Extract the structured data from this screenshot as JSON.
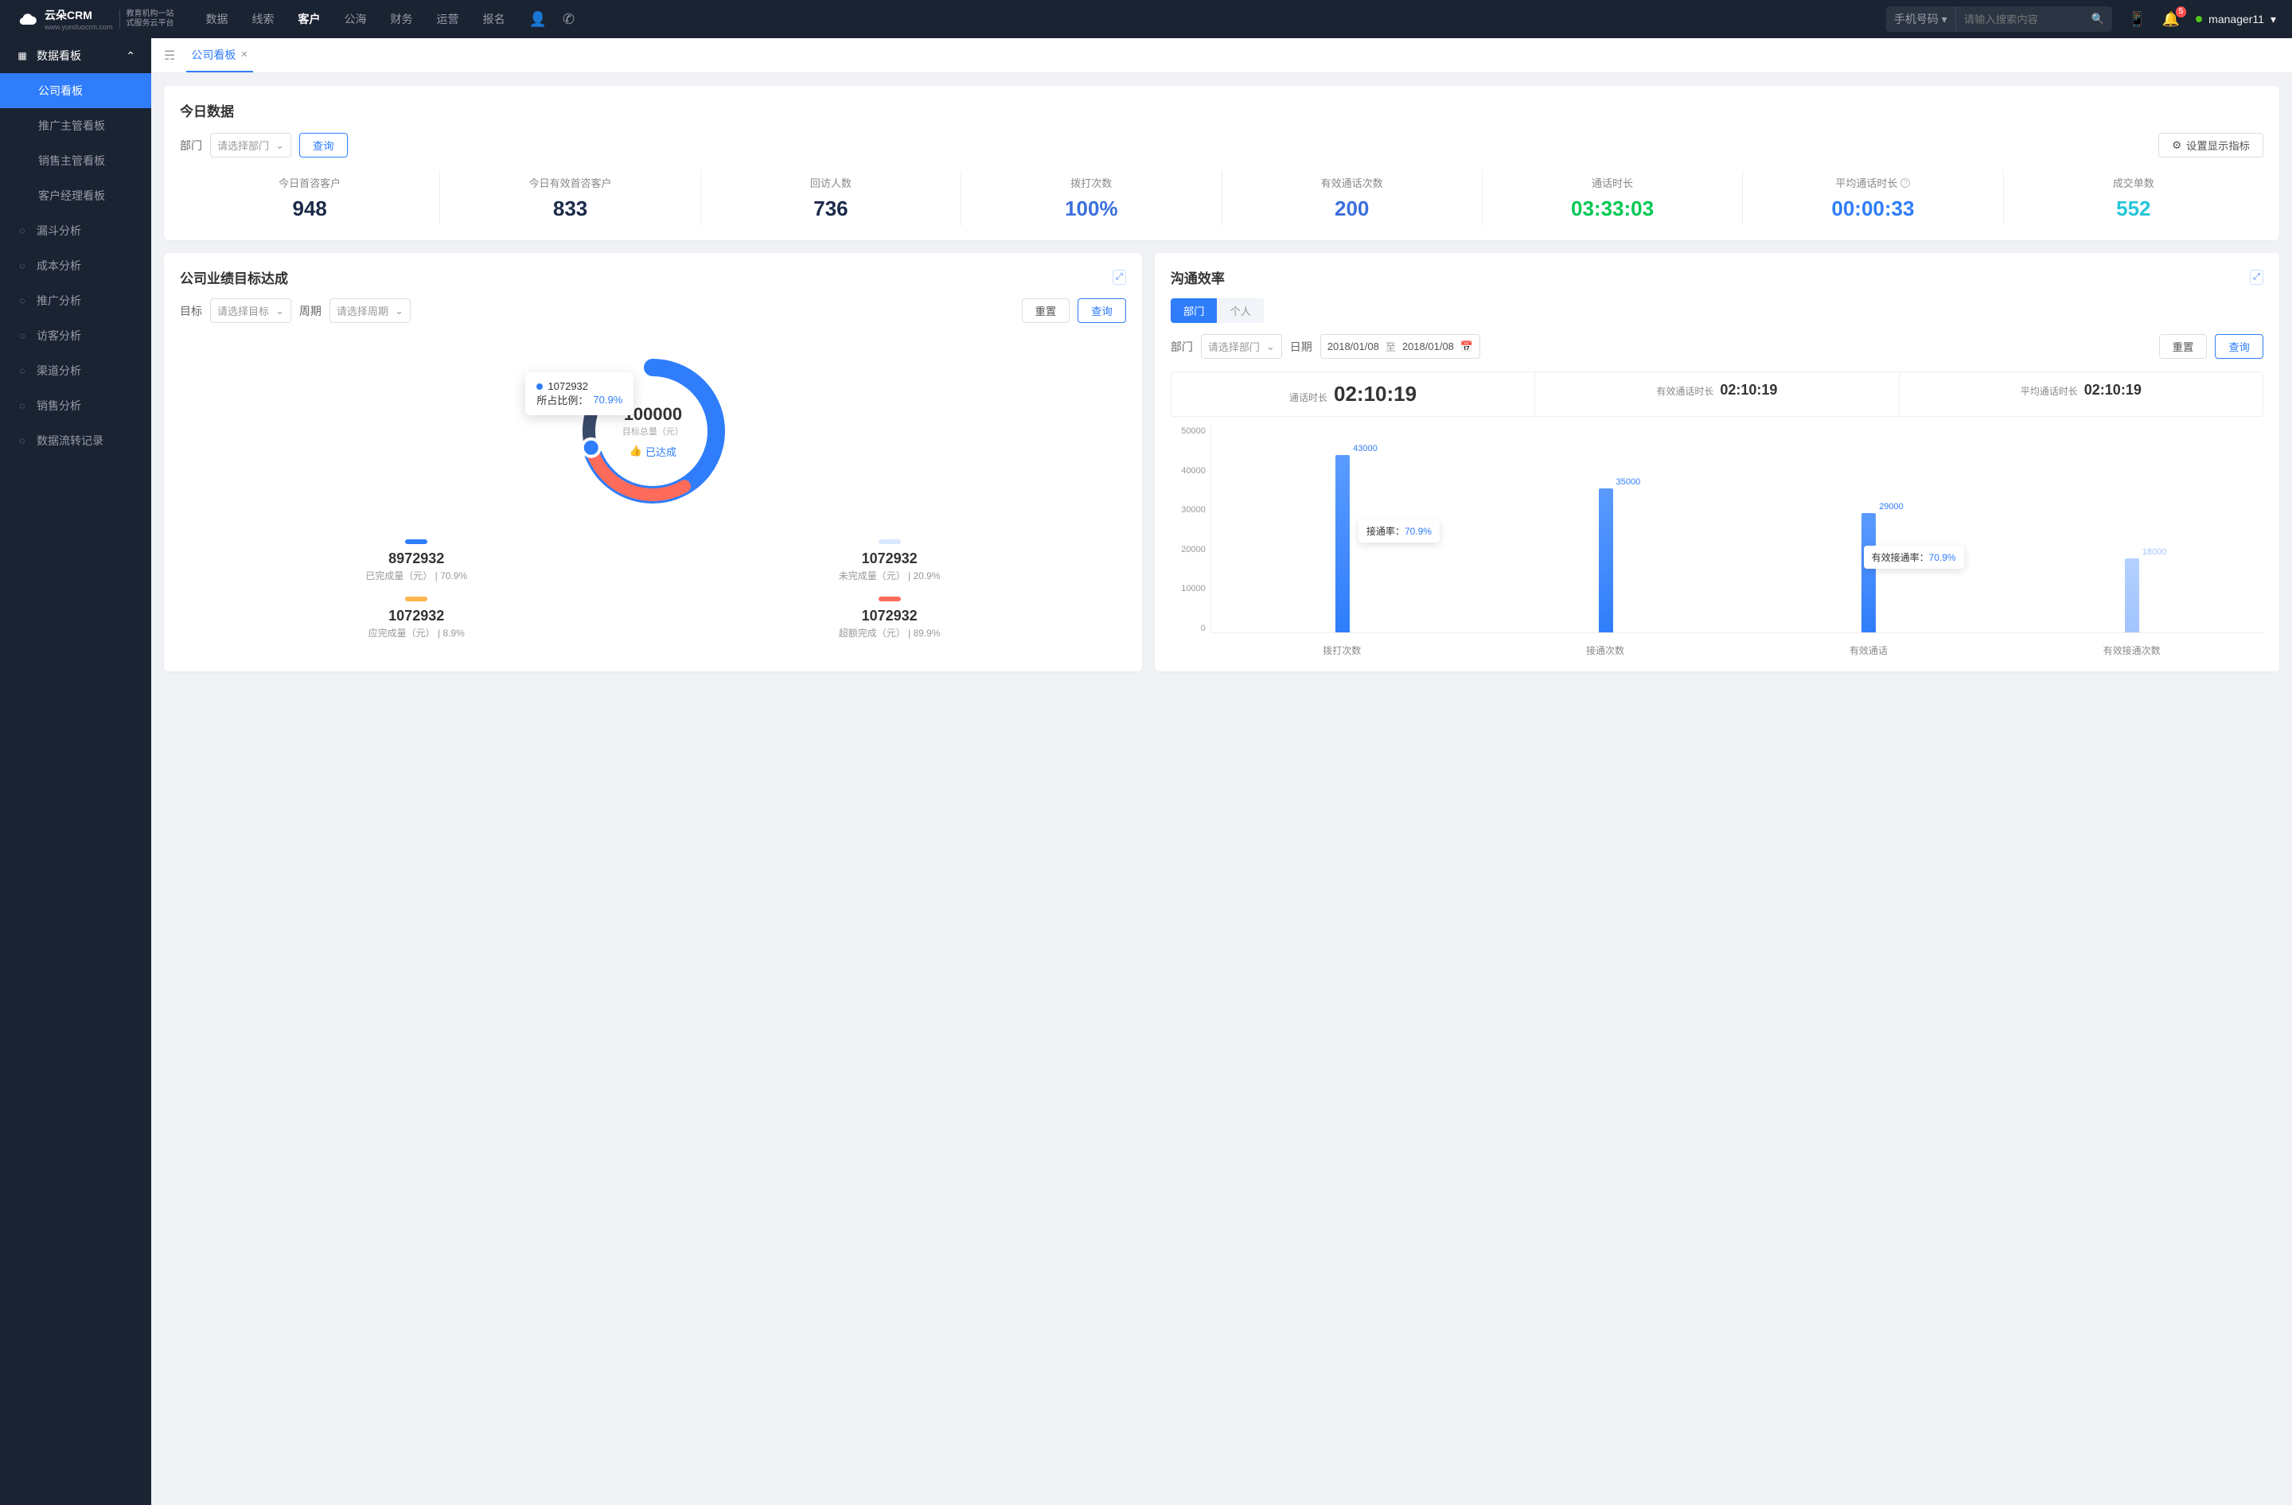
{
  "header": {
    "brand": "云朵CRM",
    "brand_sub": "www.yunduocrm.com",
    "brand_line1": "教育机构一站",
    "brand_line2": "式服务云平台",
    "nav": [
      "数据",
      "线索",
      "客户",
      "公海",
      "财务",
      "运营",
      "报名"
    ],
    "nav_active": "客户",
    "search_type": "手机号码",
    "search_placeholder": "请输入搜索内容",
    "badge": "5",
    "user": "manager11"
  },
  "sidebar": {
    "group": "数据看板",
    "subs": [
      "公司看板",
      "推广主管看板",
      "销售主管看板",
      "客户经理看板"
    ],
    "sub_active": "公司看板",
    "items": [
      {
        "icon": "filter-icon",
        "label": "漏斗分析"
      },
      {
        "icon": "clock-icon",
        "label": "成本分析"
      },
      {
        "icon": "edit-icon",
        "label": "推广分析"
      },
      {
        "icon": "headset-icon",
        "label": "访客分析"
      },
      {
        "icon": "graph-icon",
        "label": "渠道分析"
      },
      {
        "icon": "target-icon",
        "label": "销售分析"
      },
      {
        "icon": "list-icon",
        "label": "数据流转记录"
      }
    ]
  },
  "tabs": {
    "current": "公司看板"
  },
  "today": {
    "title": "今日数据",
    "dept_label": "部门",
    "dept_placeholder": "请选择部门",
    "query": "查询",
    "settings": "设置显示指标",
    "metrics": [
      {
        "label": "今日首咨客户",
        "value": "948",
        "cls": "c-dark"
      },
      {
        "label": "今日有效首咨客户",
        "value": "833",
        "cls": "c-dark"
      },
      {
        "label": "回访人数",
        "value": "736",
        "cls": "c-dark"
      },
      {
        "label": "拨打次数",
        "value": "100%",
        "cls": "c-metric-blue"
      },
      {
        "label": "有效通话次数",
        "value": "200",
        "cls": "c-metric-blue"
      },
      {
        "label": "通话时长",
        "value": "03:33:03",
        "cls": "c-green"
      },
      {
        "label": "平均通话时长",
        "value": "00:00:33",
        "cls": "c-blue",
        "info": true
      },
      {
        "label": "成交单数",
        "value": "552",
        "cls": "c-cyan"
      }
    ]
  },
  "goal": {
    "title": "公司业绩目标达成",
    "target_label": "目标",
    "target_placeholder": "请选择目标",
    "cycle_label": "周期",
    "cycle_placeholder": "请选择周期",
    "reset": "重置",
    "query": "查询",
    "center_value": "100000",
    "center_sub": "目标总量（元）",
    "status": "已达成",
    "tooltip_value": "1072932",
    "tooltip_ratio_label": "所占比例：",
    "tooltip_ratio": "70.9%",
    "legend": [
      {
        "color": "#2f7dfb",
        "value": "8972932",
        "sub": "已完成量（元） | 70.9%"
      },
      {
        "color": "#d9e8ff",
        "value": "1072932",
        "sub": "未完成量（元） | 20.9%"
      },
      {
        "color": "#ffb74d",
        "value": "1072932",
        "sub": "应完成量（元） | 8.9%"
      },
      {
        "color": "#ff6b5b",
        "value": "1072932",
        "sub": "超额完成（元） | 89.9%"
      }
    ]
  },
  "comm": {
    "title": "沟通效率",
    "toggle": [
      "部门",
      "个人"
    ],
    "toggle_active": "部门",
    "dept_label": "部门",
    "dept_placeholder": "请选择部门",
    "date_label": "日期",
    "date_from": "2018/01/08",
    "date_sep": "至",
    "date_to": "2018/01/08",
    "reset": "重置",
    "query": "查询",
    "stats": [
      {
        "label": "通话时长",
        "value": "02:10:19",
        "big": true
      },
      {
        "label": "有效通话时长",
        "value": "02:10:19"
      },
      {
        "label": "平均通话时长",
        "value": "02:10:19"
      }
    ],
    "rate1_label": "接通率：",
    "rate1_value": "70.9%",
    "rate2_label": "有效接通率：",
    "rate2_value": "70.9%"
  },
  "chart_data": {
    "donut": {
      "type": "pie",
      "title": "公司业绩目标达成",
      "total_label": "目标总量（元）",
      "total": 100000,
      "series": [
        {
          "name": "已完成量",
          "value": 8972932,
          "pct": 70.9,
          "color": "#2f7dfb"
        },
        {
          "name": "未完成量",
          "value": 1072932,
          "pct": 20.9,
          "color": "#d9e8ff"
        },
        {
          "name": "应完成量",
          "value": 1072932,
          "pct": 8.9,
          "color": "#ffb74d"
        },
        {
          "name": "超额完成",
          "value": 1072932,
          "pct": 89.9,
          "color": "#ff6b5b"
        }
      ]
    },
    "bars": {
      "type": "bar",
      "ylabel": "",
      "ylim": [
        0,
        50000
      ],
      "yticks": [
        0,
        10000,
        20000,
        30000,
        40000,
        50000
      ],
      "categories": [
        "拨打次数",
        "接通次数",
        "有效通话",
        "有效接通次数"
      ],
      "values": [
        43000,
        35000,
        29000,
        18000
      ],
      "annotations": [
        {
          "text": "接通率：70.9%",
          "between": [
            0,
            1
          ]
        },
        {
          "text": "有效接通率：70.9%",
          "between": [
            2,
            3
          ]
        }
      ]
    }
  }
}
